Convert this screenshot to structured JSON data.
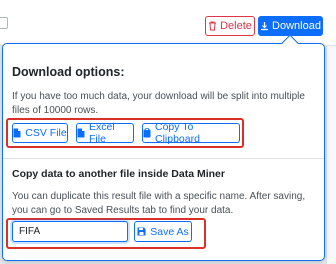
{
  "toolbar": {
    "delete_label": "Delete",
    "download_label": "Download"
  },
  "download_popover": {
    "title": "Download options:",
    "description": "If you have too much data, your download will be split into multiple files of 10000 rows.",
    "buttons": {
      "csv": "CSV File",
      "excel": "Excel File",
      "clipboard": "Copy To Clipboard"
    },
    "copy_section": {
      "title": "Copy data to another file inside Data Miner",
      "description": "You can duplicate this result file with a specific name. After saving, you can go to Saved Results tab to find your data.",
      "name_value": "FIFA",
      "save_as_label": "Save As"
    }
  },
  "icons": {
    "delete": "trash-icon",
    "download": "download-icon",
    "csv": "file-icon",
    "excel": "file-icon",
    "clipboard": "clipboard-icon",
    "save": "floppy-disk-icon"
  },
  "colors": {
    "primary": "#0d6efd",
    "danger": "#dc3545",
    "highlight": "#d9302c"
  }
}
